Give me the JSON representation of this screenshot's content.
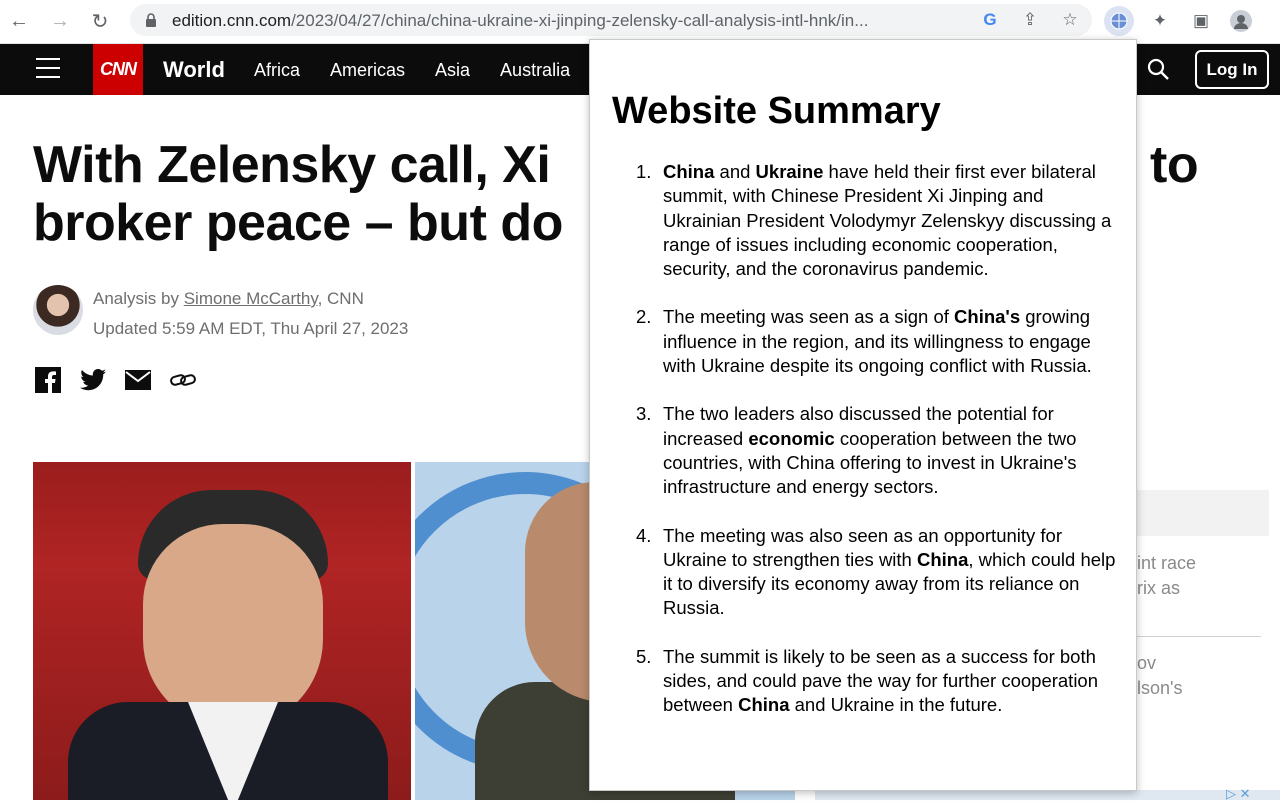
{
  "browser": {
    "url_host": "edition.cnn.com",
    "url_path": "/2023/04/27/china/china-ukraine-xi-jinping-zelensky-call-analysis-intl-hnk/in..."
  },
  "header": {
    "logo": "CNN",
    "section": "World",
    "nav": [
      "Africa",
      "Americas",
      "Asia",
      "Australia"
    ],
    "login": "Log In"
  },
  "article": {
    "headline_line1_left": "With Zelensky call, Xi",
    "headline_line1_right": "to",
    "headline_line2": "broker peace – but do",
    "byline_prefix": "Analysis by",
    "author": "Simone McCarthy",
    "byline_suffix": ", CNN",
    "updated": "Updated 5:59 AM EDT, Thu April 27, 2023"
  },
  "rail": {
    "line1": "int race",
    "line2": "rix as",
    "line3": "ov",
    "line4": "lson's"
  },
  "popup": {
    "title": "Website Summary",
    "items": [
      {
        "num": "1.",
        "html": "<b>China</b> and <b>Ukraine</b> have held their first ever bilateral summit, with Chinese President Xi Jinping and Ukrainian President Volodymyr Zelenskyy discussing a range of issues including economic cooperation, security, and the coronavirus pandemic."
      },
      {
        "num": "2.",
        "html": "The meeting was seen as a sign of <b>China's</b> growing influence in the region, and its willingness to engage with Ukraine despite its ongoing conflict with Russia."
      },
      {
        "num": "3.",
        "html": "The two leaders also discussed the potential for increased <b>economic</b> cooperation between the two countries, with China offering to invest in Ukraine's infrastructure and energy sectors."
      },
      {
        "num": "4.",
        "html": "The meeting was also seen as an opportunity for Ukraine to strengthen ties with <b>China</b>, which could help it to diversify its economy away from its reliance on Russia."
      },
      {
        "num": "5.",
        "html": "The summit is likely to be seen as a success for both sides, and could pave the way for further cooperation between <b>China</b> and Ukraine in the future."
      }
    ]
  }
}
